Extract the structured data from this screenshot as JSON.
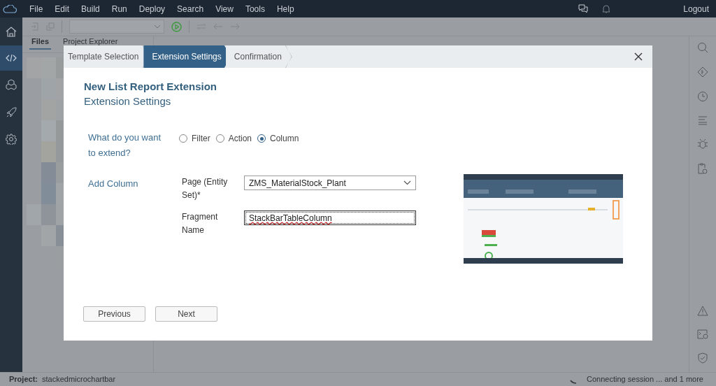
{
  "menu_bar": {
    "items": [
      "File",
      "Edit",
      "Build",
      "Run",
      "Deploy",
      "Search",
      "View",
      "Tools",
      "Help"
    ],
    "logout": "Logout"
  },
  "panel_tabs": [
    {
      "label": "Files",
      "selected": true
    },
    {
      "label": "Project Explorer",
      "selected": false
    }
  ],
  "dialog": {
    "steps": [
      {
        "label": "Template Selection",
        "selected": false
      },
      {
        "label": "Extension Settings",
        "selected": true
      },
      {
        "label": "Confirmation",
        "selected": false
      }
    ],
    "title": "New List Report Extension",
    "subtitle": "Extension Settings",
    "question": "What do you want to extend?",
    "options": [
      {
        "label": "Filter",
        "selected": false
      },
      {
        "label": "Action",
        "selected": false
      },
      {
        "label": "Column",
        "selected": true
      }
    ],
    "section": "Add Column",
    "fields": [
      {
        "kind": "dropdown",
        "label": "Page (Entity Set)*",
        "value": "ZMS_MaterialStock_Plant",
        "focused": false
      },
      {
        "kind": "text",
        "label": "Fragment Name",
        "value": "StackBarTableColumn",
        "focused": true
      }
    ],
    "preview": {
      "kind": "picture"
    },
    "buttons": [
      "Previous",
      "Next"
    ]
  },
  "status_bar": {
    "project_label": "Project:",
    "project": "stackedmicrochartbar",
    "message": "Connecting session ... and 1 more"
  }
}
